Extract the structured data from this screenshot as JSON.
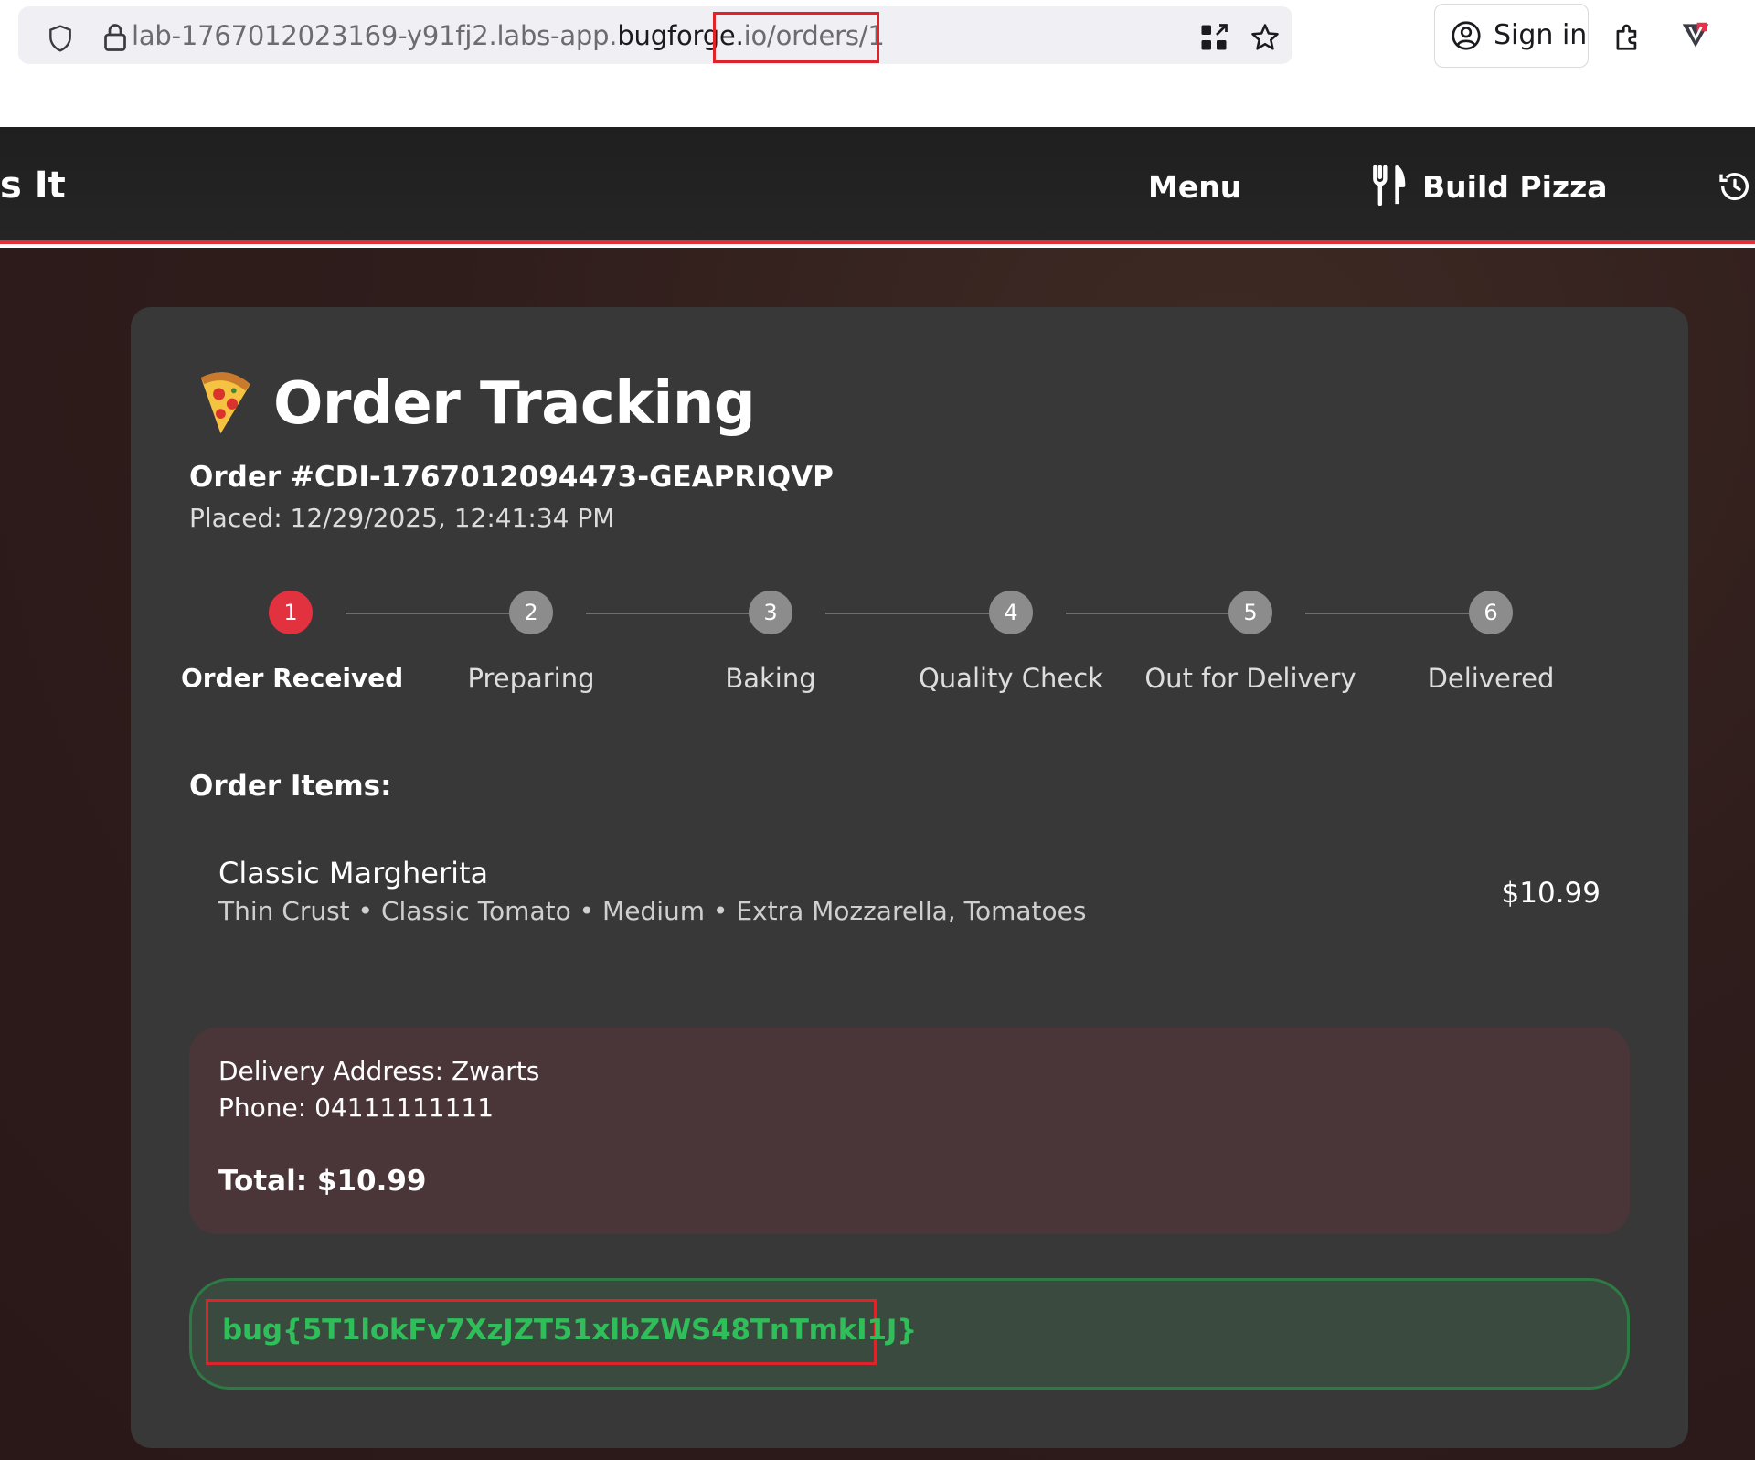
{
  "browser": {
    "url_prefix": "lab-1767012023169-y91fj2.labs-app.",
    "url_domain": "bugforge",
    "url_dot": ".",
    "url_suffix": "io/orders/1",
    "signin_label": "Sign in",
    "icons": [
      "shield-icon",
      "lock-icon",
      "qr-code-icon",
      "star-icon",
      "account-icon",
      "extension-icon",
      "pocket-icon"
    ]
  },
  "nav": {
    "brand": "s It",
    "menu_label": "Menu",
    "build_label": "Build Pizza",
    "icons": [
      "fork-knife-icon",
      "history-icon"
    ]
  },
  "order": {
    "title": "Order Tracking",
    "number": "Order #CDI-1767012094473-GEAPRIQVP",
    "placed": "Placed: 12/29/2025, 12:41:34 PM",
    "steps": [
      {
        "num": "1",
        "label": "Order Received",
        "active": true
      },
      {
        "num": "2",
        "label": "Preparing",
        "active": false
      },
      {
        "num": "3",
        "label": "Baking",
        "active": false
      },
      {
        "num": "4",
        "label": "Quality Check",
        "active": false
      },
      {
        "num": "5",
        "label": "Out for Delivery",
        "active": false
      },
      {
        "num": "6",
        "label": "Delivered",
        "active": false
      }
    ],
    "items_heading": "Order Items:",
    "items": [
      {
        "name": "Classic Margherita",
        "details": "Thin Crust • Classic Tomato • Medium • Extra Mozzarella, Tomatoes",
        "price": "$10.99"
      }
    ],
    "delivery_address": "Delivery Address: Zwarts",
    "phone": "Phone: 04111111111",
    "total": "Total: $10.99",
    "flag": "bug{5T1lokFv7XzJZT51xlbZWS48TnTmkI1J}"
  },
  "colors": {
    "accent": "#e2323f",
    "flag_green": "#2fbe5a",
    "highlight_red": "#e0232b"
  }
}
